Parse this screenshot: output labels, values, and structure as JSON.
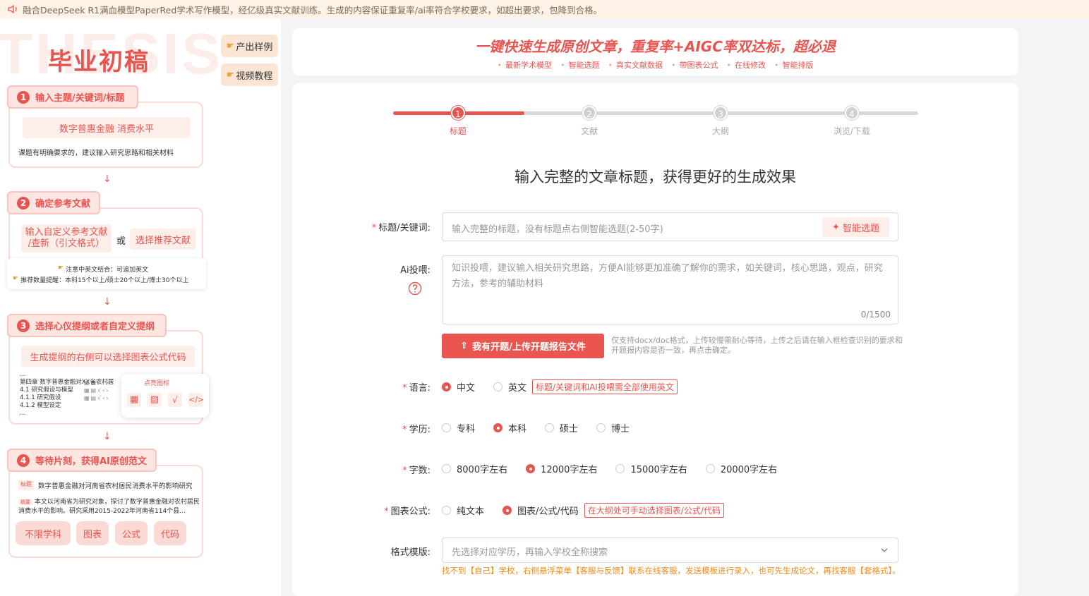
{
  "notice": {
    "icon": "speaker-icon",
    "text": "融合DeepSeek R1满血模型PaperRed学术写作模型，经亿级真实文献训练。生成的内容保证重复率/ai率符合学校要求，如超出要求，包降到合格。"
  },
  "left": {
    "bg_word": "THESIS",
    "title": "毕业初稿",
    "side_buttons": [
      "产出样例",
      "视频教程"
    ],
    "step1": {
      "num": "1",
      "label": "输入主题/关键词/标题",
      "pill": "数字普惠金融  消费水平",
      "hint": "课题有明确要求的，建议输入研究思路和相关材料"
    },
    "step2": {
      "num": "2",
      "label": "确定参考文献",
      "option_a": "输入自定义参考文献\n/查新（引文格式）",
      "or": "或",
      "option_b": "选择推荐文献",
      "tip1": "注意中英文结合：可追加英文",
      "tip2": "推荐数量提醒：本科15个以上/硕士20个以上/博士30个以上"
    },
    "step3": {
      "num": "3",
      "label": "选择心仪提纲或者自定义提纲",
      "pill": "生成提纲的右侧可以选择图表公式代码",
      "outline": [
        "...",
        "第四章 数字普惠金融对XX省农村居",
        "4.1 研究假设与模型",
        "4.1.1 研究假设",
        "4.1.2 模型设定",
        "..."
      ],
      "popup_label": "点亮图标"
    },
    "step4": {
      "num": "4",
      "label": "等待片刻，获得AI原创范文",
      "title_tag": "标题",
      "title_text": "数字普惠金融对河南省农村居民消费水平的影响研究",
      "abstract_tag": "摘要",
      "abstract_text": "本文以河南省为研究对象，探讨了数字普惠金融对农村居民消费水平的影响。研究采用2015-2022年河南省114个县...",
      "badges": [
        "不限学科",
        "图表",
        "公式",
        "代码"
      ]
    }
  },
  "hero": {
    "title": "一键快速生成原创文章，重复率+AIGC率双达标，超必退",
    "features": [
      "最新学术模型",
      "智能选题",
      "真实文献数据",
      "带图表公式",
      "在线修改",
      "智能排版"
    ]
  },
  "progress": {
    "value": 0.25,
    "steps": [
      {
        "num": "1",
        "label": "标题"
      },
      {
        "num": "2",
        "label": "文献"
      },
      {
        "num": "3",
        "label": "大纲"
      },
      {
        "num": "4",
        "label": "浏览/下载"
      }
    ]
  },
  "form": {
    "heading": "输入完整的文章标题，获得更好的生成效果",
    "title_label": "标题/关键词:",
    "title_placeholder": "输入完整的标题，没有标题点右侧智能选题(2-50字)",
    "smart_button": "智能选题",
    "ai_label": "Ai投喂:",
    "ai_placeholder": "知识投喂，建议输入相关研究思路，方便AI能够更加准确了解你的需求，如关键词，核心思路，观点，研究方法，参考的辅助材料",
    "ai_counter": "0/1500",
    "upload_button": "我有开题/上传开题报告文件",
    "upload_note": "仅支持docx/doc格式，上传较慢需耐心等待，上传之后请在输入框检查识别的要求和开题报内容是否一致，再点击确定。",
    "language": {
      "label": "语言:",
      "options": [
        "中文",
        "英文"
      ],
      "selected": "中文",
      "note": "标题/关键词和AI投喂需全部使用英文"
    },
    "degree": {
      "label": "学历:",
      "options": [
        "专科",
        "本科",
        "硕士",
        "博士"
      ],
      "selected": "本科"
    },
    "words": {
      "label": "字数:",
      "options": [
        "8000字左右",
        "12000字左右",
        "15000字左右",
        "20000字左右"
      ],
      "selected": "12000字左右"
    },
    "chart": {
      "label": "图表公式:",
      "options": [
        "纯文本",
        "图表/公式/代码"
      ],
      "selected": "图表/公式/代码",
      "note": "在大纲处可手动选择图表/公式/代码"
    },
    "template": {
      "label": "格式模版:",
      "placeholder": "先选择对应学历，再输入学校全称搜索",
      "hint": "找不到【自己】学校，右侧悬浮菜单【客服与反馈】联系在线客服，发送模板进行录入，也可先生成论文，再找客服【套格式】。"
    }
  },
  "colors": {
    "accent": "#e8544f",
    "notice_bg": "#fdf2e6",
    "hint_orange": "#f08a1c"
  }
}
